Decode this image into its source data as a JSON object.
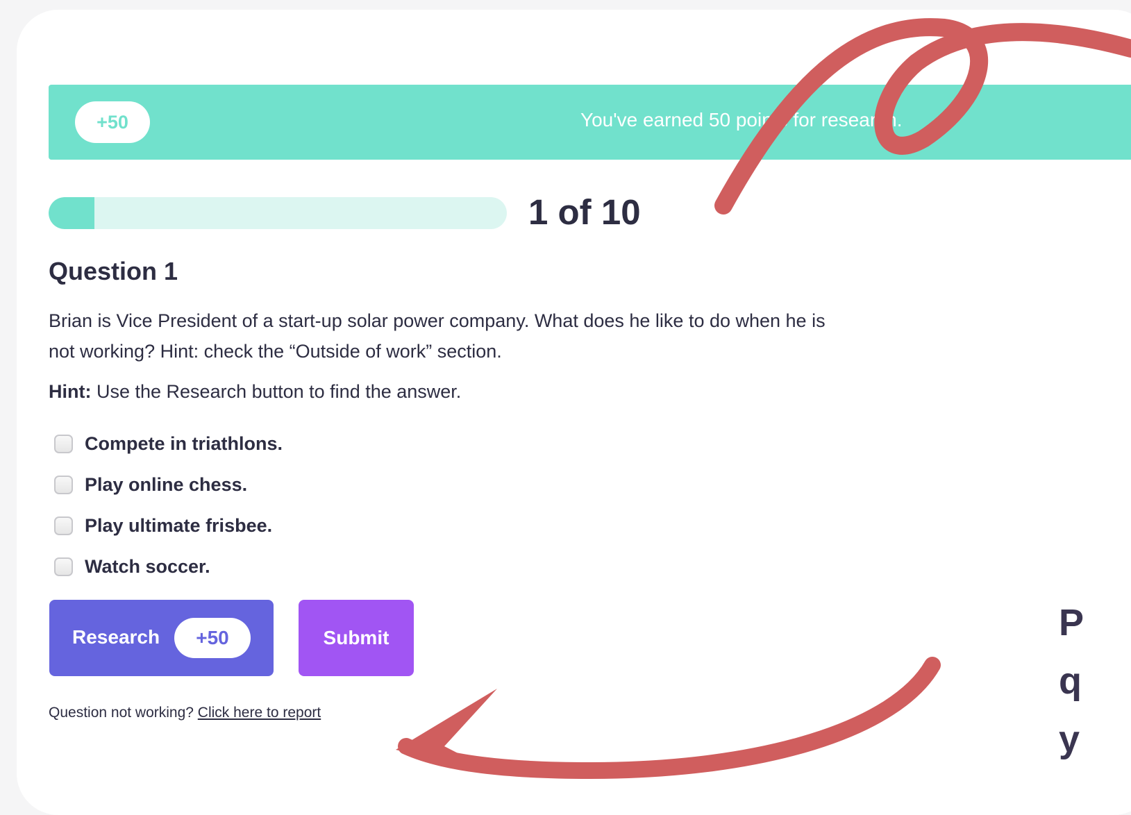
{
  "banner": {
    "points": "+50",
    "message": "You've earned 50 points for research."
  },
  "progress": {
    "label": "1 of 10",
    "current": 1,
    "total": 10
  },
  "question": {
    "title": "Question 1",
    "text": "Brian is Vice President of a start-up solar power company. What does he like to do when he is not working? Hint: check the “Outside of work” section.",
    "hint_label": "Hint:",
    "hint_text": " Use the Research button to find the answer.",
    "options": [
      {
        "label": "Compete in triathlons.",
        "checked": false
      },
      {
        "label": "Play online chess.",
        "checked": false
      },
      {
        "label": "Play ultimate frisbee.",
        "checked": false
      },
      {
        "label": "Watch soccer.",
        "checked": false
      }
    ]
  },
  "buttons": {
    "research_label": "Research",
    "research_points": "+50",
    "submit_label": "Submit"
  },
  "footer": {
    "prompt": "Question not working? ",
    "link": "Click here to report"
  },
  "side_text": {
    "lines": [
      "P",
      "q",
      "y"
    ]
  },
  "colors": {
    "teal": "#71e1cc",
    "teal_light": "#dcf6f1",
    "research_blue": "#6564de",
    "submit_purple": "#a155f3",
    "annotation_red": "#d05e5e",
    "text_dark": "#2d2d42"
  }
}
